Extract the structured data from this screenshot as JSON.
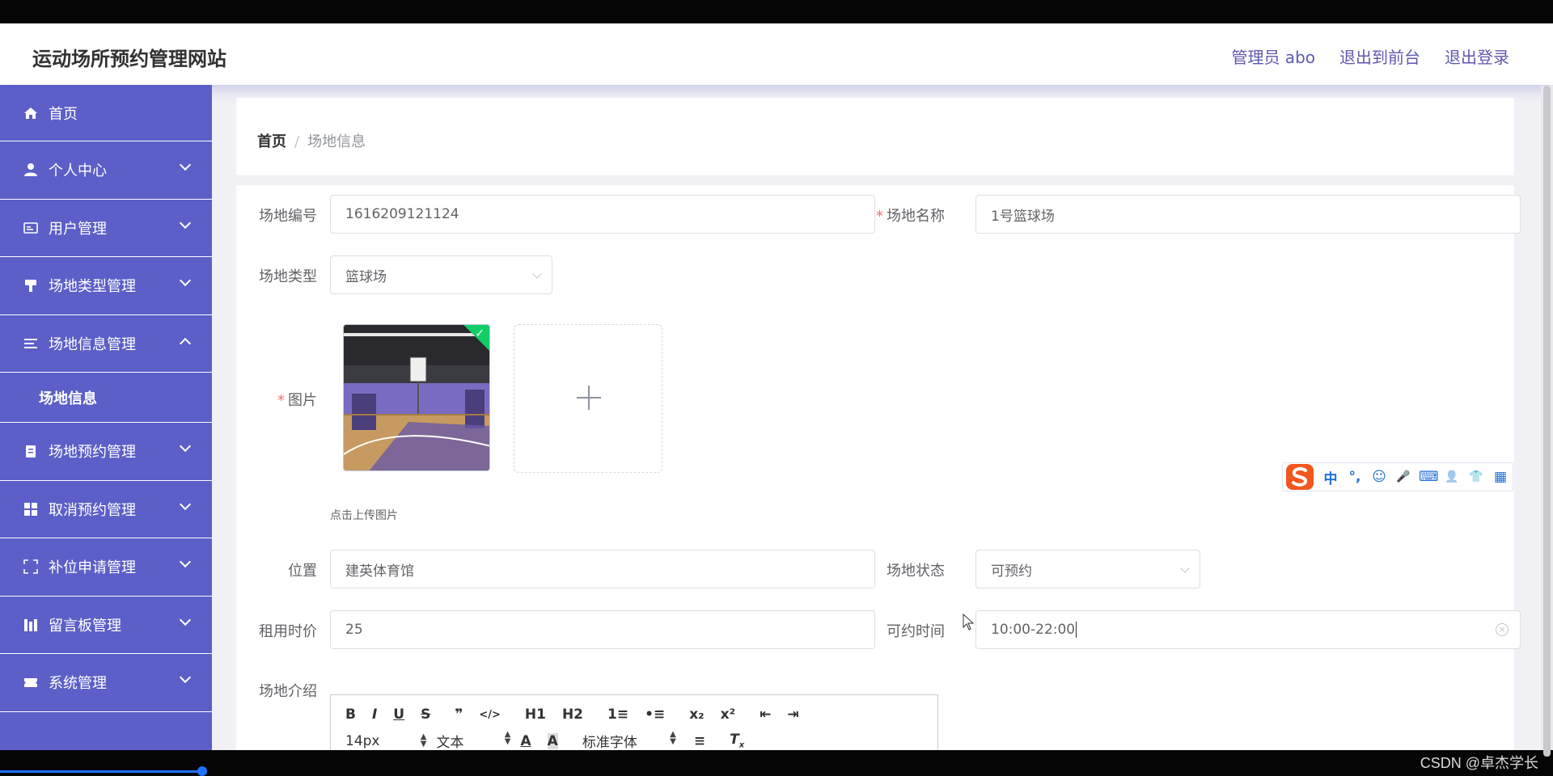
{
  "app": {
    "title": "运动场所预约管理网站",
    "header_links": [
      "管理员 abo",
      "退出到前台",
      "退出登录"
    ]
  },
  "sidebar": {
    "items": [
      {
        "label": "首页",
        "icon": "home-icon",
        "expandable": false
      },
      {
        "label": "个人中心",
        "icon": "user-icon",
        "expandable": true
      },
      {
        "label": "用户管理",
        "icon": "id-card-icon",
        "expandable": true
      },
      {
        "label": "场地类型管理",
        "icon": "brush-icon",
        "expandable": true
      },
      {
        "label": "场地信息管理",
        "icon": "list-icon",
        "expandable": true,
        "expanded": true
      },
      {
        "label": "场地预约管理",
        "icon": "clipboard-icon",
        "expandable": true
      },
      {
        "label": "取消预约管理",
        "icon": "grid-icon",
        "expandable": true
      },
      {
        "label": "补位申请管理",
        "icon": "fullscreen-icon",
        "expandable": true
      },
      {
        "label": "留言板管理",
        "icon": "board-icon",
        "expandable": true
      },
      {
        "label": "系统管理",
        "icon": "ticket-icon",
        "expandable": true
      }
    ],
    "submenu": {
      "label": "场地信息"
    }
  },
  "breadcrumb": {
    "home": "首页",
    "separator": "/",
    "current": "场地信息"
  },
  "form": {
    "venue_no": {
      "label": "场地编号",
      "value": "1616209121124"
    },
    "venue_name": {
      "label": "场地名称",
      "value": "1号篮球场",
      "required": true
    },
    "venue_type": {
      "label": "场地类型",
      "value": "篮球场"
    },
    "image": {
      "label": "图片",
      "required": true,
      "tip": "点击上传图片"
    },
    "location": {
      "label": "位置",
      "value": "建英体育馆"
    },
    "status": {
      "label": "场地状态",
      "value": "可预约"
    },
    "price": {
      "label": "租用时价",
      "value": "25"
    },
    "available_time": {
      "label": "可约时间",
      "value": "10:00-22:00"
    },
    "intro": {
      "label": "场地介绍"
    }
  },
  "editor": {
    "row1": [
      "B",
      "I",
      "U",
      "S",
      "❞",
      "</>",
      "H1",
      "H2",
      "1≡",
      "•≡",
      "x₂",
      "x²",
      "⇤",
      "⇥"
    ],
    "font_size": "14px",
    "block_type": "文本",
    "font_family": "标准字体"
  },
  "ime": {
    "glyphs": [
      "中",
      "°,",
      "☺",
      "🎤",
      "⌨",
      "👤",
      "👕",
      "▦"
    ]
  },
  "watermark": "CSDN @卓杰学长",
  "colors": {
    "sidebar": "#5b5fc7",
    "accent_text": "#5d5ab0",
    "required": "#f56c6c",
    "success": "#13ce66"
  }
}
